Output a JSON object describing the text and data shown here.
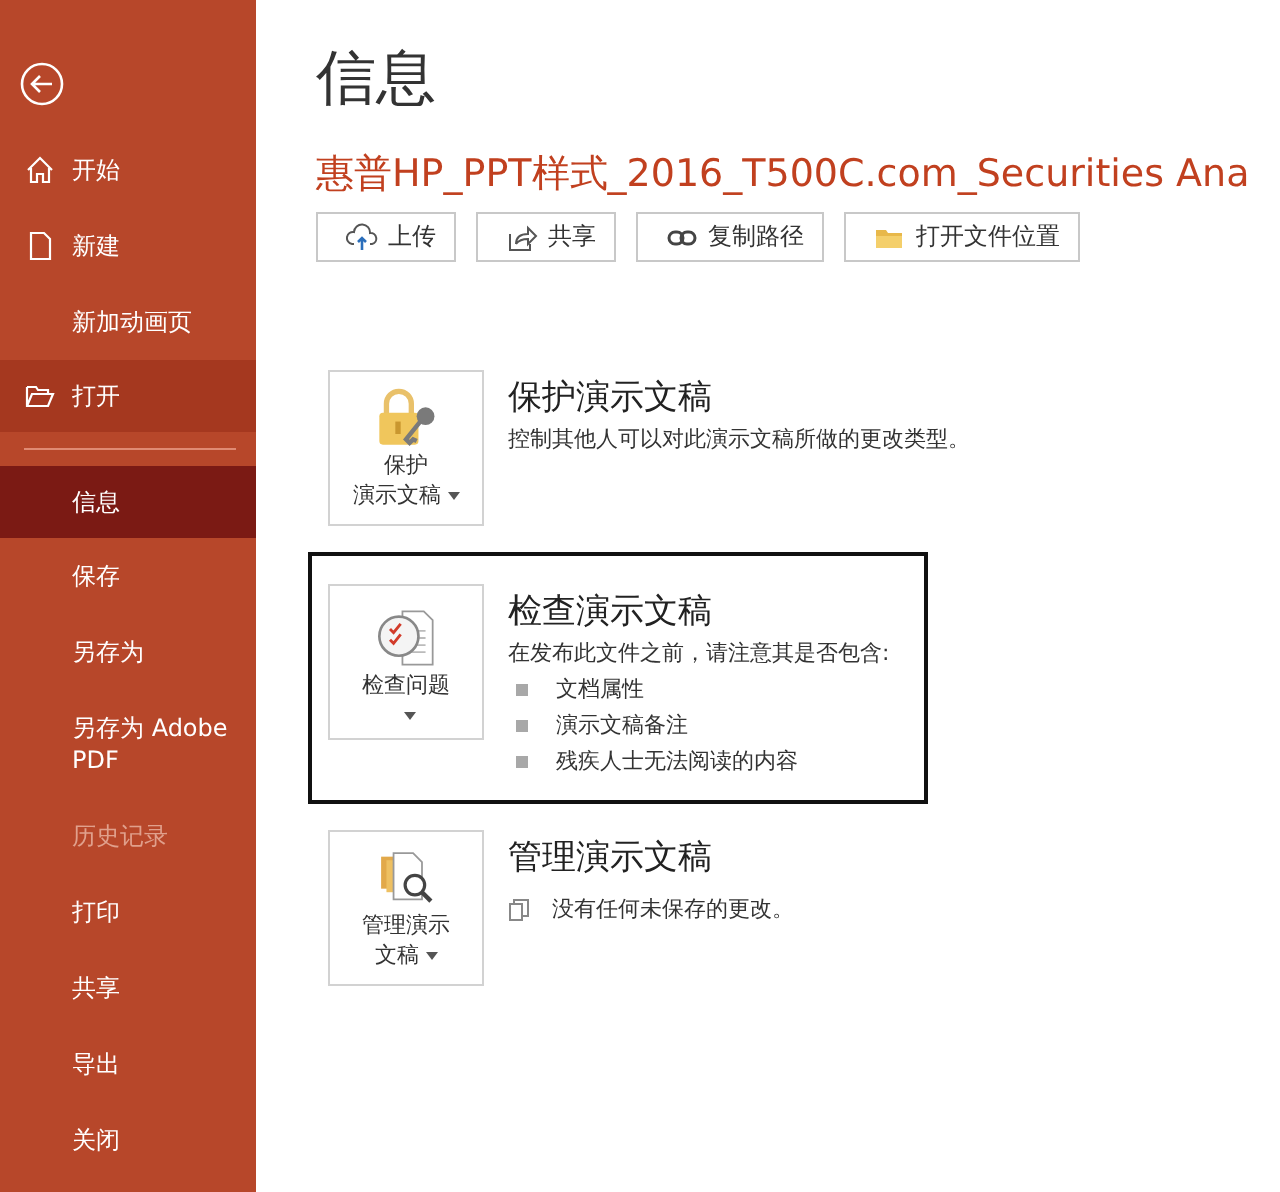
{
  "sidebar": {
    "items": [
      {
        "label": "开始",
        "kind": "home",
        "selected": false,
        "highlighted": false,
        "disabled": false
      },
      {
        "label": "新建",
        "kind": "page",
        "selected": false,
        "highlighted": false,
        "disabled": false
      },
      {
        "label": "新加动画页",
        "kind": "plain",
        "selected": false,
        "highlighted": false,
        "disabled": false
      },
      {
        "label": "打开",
        "kind": "folder",
        "selected": false,
        "highlighted": true,
        "disabled": false
      },
      {
        "label": "信息",
        "kind": "plain",
        "selected": true,
        "highlighted": false,
        "disabled": false
      },
      {
        "label": "保存",
        "kind": "plain",
        "selected": false,
        "highlighted": false,
        "disabled": false
      },
      {
        "label": "另存为",
        "kind": "plain",
        "selected": false,
        "highlighted": false,
        "disabled": false
      },
      {
        "label": "另存为 Adobe PDF",
        "kind": "plain",
        "selected": false,
        "highlighted": false,
        "disabled": false
      },
      {
        "label": "历史记录",
        "kind": "plain",
        "selected": false,
        "highlighted": false,
        "disabled": true
      },
      {
        "label": "打印",
        "kind": "plain",
        "selected": false,
        "highlighted": false,
        "disabled": false
      },
      {
        "label": "共享",
        "kind": "plain",
        "selected": false,
        "highlighted": false,
        "disabled": false
      },
      {
        "label": "导出",
        "kind": "plain",
        "selected": false,
        "highlighted": false,
        "disabled": false
      },
      {
        "label": "关闭",
        "kind": "plain",
        "selected": false,
        "highlighted": false,
        "disabled": false
      }
    ]
  },
  "page_title": "信息",
  "file_name": "惠普HP_PPT样式_2016_T500C.com_Securities Ana",
  "file_actions": [
    {
      "label": "上传",
      "kind": "upload"
    },
    {
      "label": "共享",
      "kind": "share"
    },
    {
      "label": "复制路径",
      "kind": "link"
    },
    {
      "label": "打开文件位置",
      "kind": "folder"
    }
  ],
  "sections": [
    {
      "kind": "protect",
      "button_label": [
        "保护",
        "演示文稿"
      ],
      "title": "保护演示文稿",
      "description": "控制其他人可以对此演示文稿所做的更改类型。",
      "highlighted": false
    },
    {
      "kind": "inspect",
      "button_label": [
        "检查问题"
      ],
      "title": "检查演示文稿",
      "description": "在发布此文件之前，请注意其是否包含:",
      "bullets": [
        "文档属性",
        "演示文稿备注",
        "残疾人士无法阅读的内容"
      ],
      "highlighted": true
    },
    {
      "kind": "manage",
      "button_label": [
        "管理演示",
        "文稿"
      ],
      "title": "管理演示文稿",
      "note": "没有任何未保存的更改。",
      "highlighted": false
    }
  ]
}
